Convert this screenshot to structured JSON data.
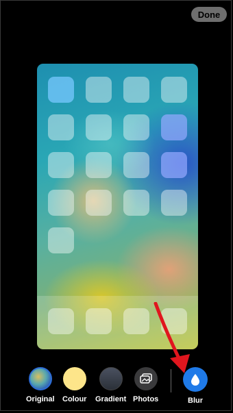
{
  "header": {
    "done_label": "Done"
  },
  "preview": {
    "home_rows": 5,
    "dock_icon_count": 4
  },
  "toolbar": {
    "items": [
      {
        "label": "Original",
        "icon": "original-wallpaper-swatch",
        "selected": true
      },
      {
        "label": "Colour",
        "icon": "colour-swatch",
        "color": "#FDE58A"
      },
      {
        "label": "Gradient",
        "icon": "gradient-swatch"
      },
      {
        "label": "Photos",
        "icon": "photos-icon"
      },
      {
        "label": "Blur",
        "icon": "blur-drop-icon",
        "color": "#1F7AE8"
      }
    ]
  },
  "annotation": {
    "arrow_color": "#E0161E",
    "points_to": "Blur"
  }
}
